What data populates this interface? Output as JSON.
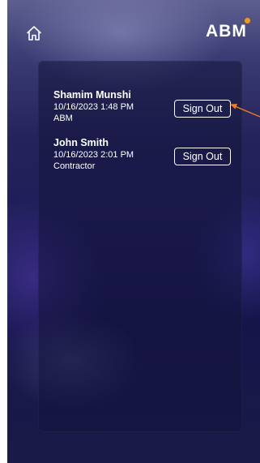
{
  "header": {
    "home_icon": "home-icon",
    "logo": {
      "text": "ABM",
      "accent_color": "#f39a1e"
    }
  },
  "signins": [
    {
      "name": "Shamim Munshi",
      "datetime": "10/16/2023 1:48 PM",
      "company": "ABM",
      "button_label": "Sign Out"
    },
    {
      "name": "John Smith",
      "datetime": "10/16/2023 2:01 PM",
      "company": "Contractor",
      "button_label": "Sign Out"
    }
  ],
  "annotation": {
    "arrow_color": "#f27c22"
  }
}
